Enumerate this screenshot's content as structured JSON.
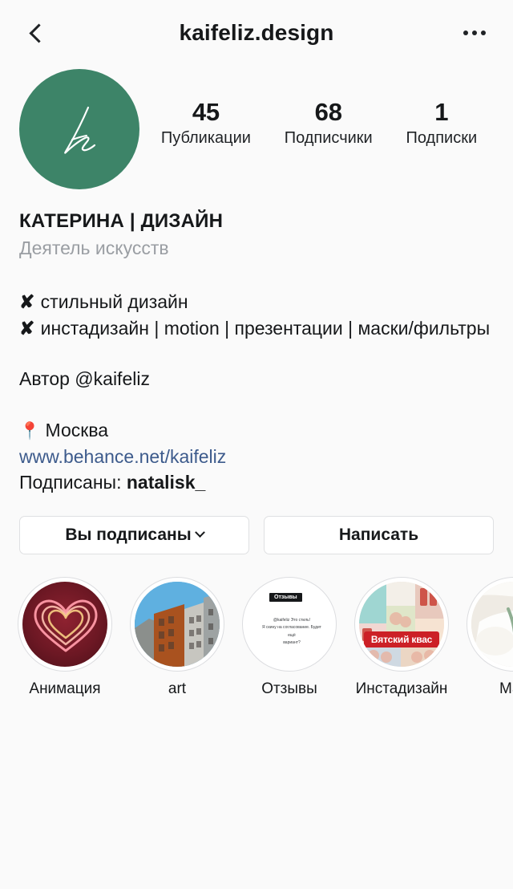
{
  "header": {
    "back_icon": "chevron-left-icon",
    "title": "kaifeliz.design",
    "more_icon": "more-options-icon"
  },
  "profile": {
    "avatar": {
      "icon": "avatar-monogram-k",
      "background_color": "#3d8468",
      "monogram": "k"
    },
    "stats": [
      {
        "value": "45",
        "label": "Публикации"
      },
      {
        "value": "68",
        "label": "Подписчики"
      },
      {
        "value": "1",
        "label": "Подписки"
      }
    ]
  },
  "bio": {
    "name": "КАТЕРИНА | ДИЗАЙН",
    "category": "Деятель искусств",
    "lines": [
      "✘ стильный дизайн",
      "✘ инстадизайн | motion | презентации | маски/фильтры"
    ],
    "bullet_glyph": "✘",
    "line_texts": [
      "стильный дизайн",
      "инстадизайн | motion | презентации | маски/фильтры"
    ],
    "author": "Автор @kaifeliz",
    "location_icon": "📍",
    "location": "Москва",
    "link": "www.behance.net/kaifeliz",
    "link_color": "#3d5b8c",
    "followed_by_label": "Подписаны:",
    "followed_by_user": "natalisk_"
  },
  "actions": {
    "follow_label": "Вы подписаны",
    "follow_caret_icon": "chevron-down-icon",
    "message_label": "Написать"
  },
  "highlights": [
    {
      "label": "Анимация",
      "thumb": "neon-heart-thumbnail",
      "style": "th-heart"
    },
    {
      "label": "art",
      "thumb": "architecture-thumbnail",
      "style": "th-arch"
    },
    {
      "label": "Отзывы",
      "thumb": "review-screenshot-thumbnail",
      "style": "th-white",
      "badge": "Отзывы",
      "caption_lines": [
        "@kaifeliz Это стиль!",
        "Я скину на согласование. Будет ещё",
        "вариант?"
      ]
    },
    {
      "label": "Инстадизайн",
      "thumb": "collage-thumbnail",
      "style": "th-collage",
      "banner": "Вятский квас"
    },
    {
      "label": "Мас",
      "thumb": "mask-thumbnail",
      "style": "th-mask"
    }
  ]
}
